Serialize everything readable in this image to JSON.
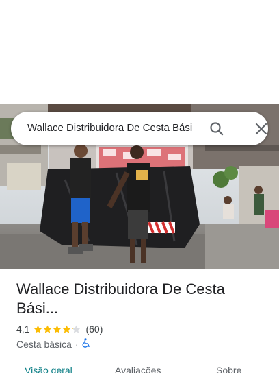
{
  "search": {
    "query": "Wallace Distribuidora De Cesta Bási"
  },
  "place": {
    "title": "Wallace Distribuidora De Cesta Bási...",
    "rating": "4,1",
    "rating_value": 4.1,
    "rating_max": 5,
    "review_count": "(60)",
    "category": "Cesta básica",
    "separator": "·"
  },
  "tabs": [
    {
      "label": "Visão geral",
      "active": true
    },
    {
      "label": "Avaliações",
      "active": false
    },
    {
      "label": "Sobre",
      "active": false
    }
  ],
  "colors": {
    "star": "#fbbc04",
    "star_empty": "#dadce0",
    "accent": "#0b7e85",
    "accessibility": "#1a73e8"
  },
  "icons": {
    "search": "search-icon",
    "close": "close-icon",
    "accessible": "wheelchair-accessible-icon"
  }
}
